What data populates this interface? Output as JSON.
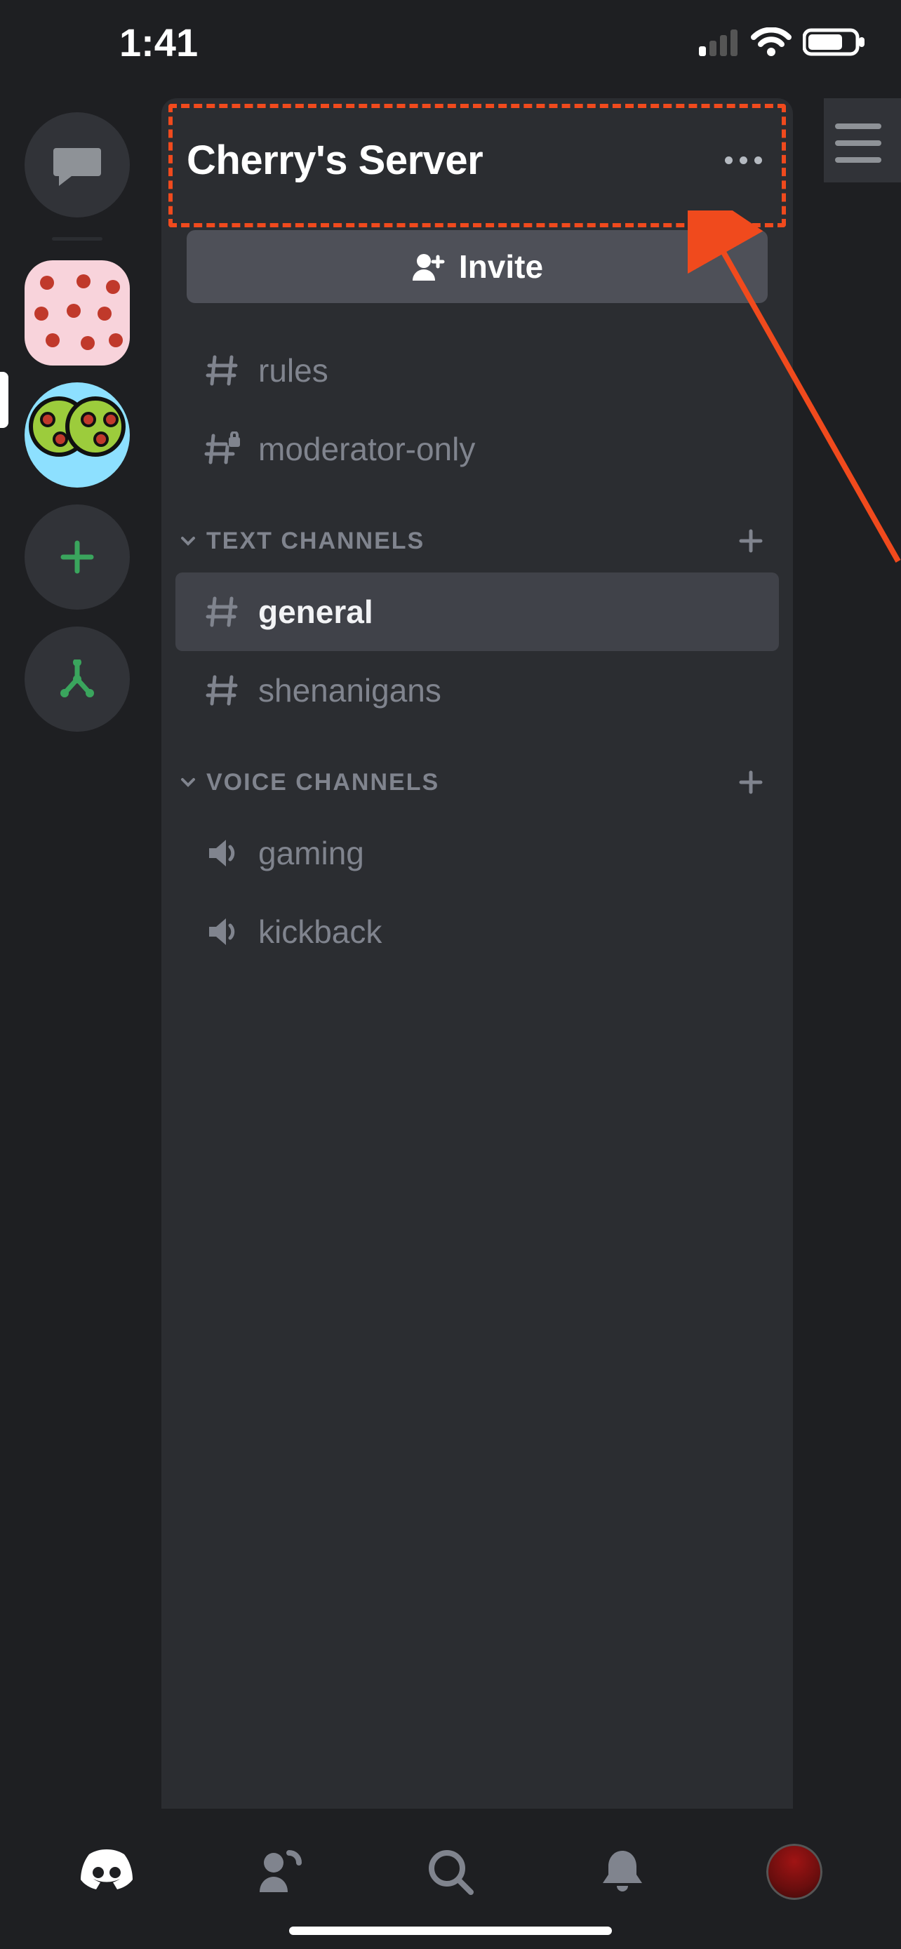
{
  "status": {
    "time": "1:41"
  },
  "server": {
    "title": "Cherry's Server",
    "invite_label": "Invite"
  },
  "top_channels": [
    {
      "name": "rules",
      "locked": false
    },
    {
      "name": "moderator-only",
      "locked": true
    }
  ],
  "categories": [
    {
      "label": "TEXT CHANNELS",
      "kind": "text",
      "channels": [
        {
          "name": "general",
          "selected": true
        },
        {
          "name": "shenanigans",
          "selected": false
        }
      ]
    },
    {
      "label": "VOICE CHANNELS",
      "kind": "voice",
      "channels": [
        {
          "name": "gaming"
        },
        {
          "name": "kickback"
        }
      ]
    }
  ],
  "colors": {
    "annotation": "#f04a1d",
    "accent_add": "#3aa55d"
  }
}
